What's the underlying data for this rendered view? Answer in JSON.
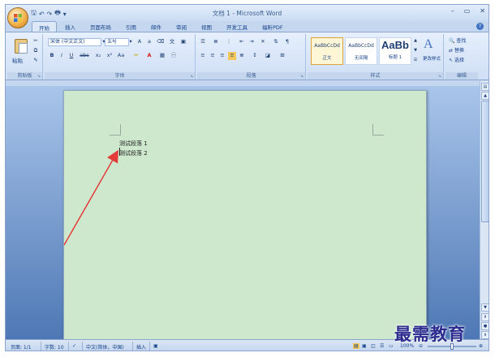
{
  "window": {
    "title": "文档 1 - Microsoft Word",
    "controls": [
      "–",
      "▭",
      "✕"
    ]
  },
  "quick_access": {
    "save": "🖫",
    "undo": "↶",
    "redo": "↷",
    "print": "🖶",
    "more": "▾"
  },
  "tabs": [
    "开始",
    "插入",
    "页面布局",
    "引用",
    "邮件",
    "审阅",
    "视图",
    "开发工具",
    "福昕PDF"
  ],
  "active_tab": "开始",
  "ribbon": {
    "clipboard": {
      "label": "剪贴板",
      "paste": "粘贴"
    },
    "font": {
      "label": "字体",
      "font_name": "宋体 (中文正文)",
      "font_size": "五号",
      "format_buttons": [
        "B",
        "I",
        "U",
        "abc",
        "x₂",
        "x²",
        "Aa",
        "A"
      ]
    },
    "paragraph": {
      "label": "段落"
    },
    "styles": {
      "label": "样式",
      "items": [
        {
          "sample": "AaBbCcDd",
          "name": "正文",
          "selected": true
        },
        {
          "sample": "AaBbCcDd",
          "name": "无间隔",
          "selected": false
        },
        {
          "sample": "AaBb",
          "name": "标题 1",
          "selected": false
        }
      ],
      "change_styles": "更改样式"
    },
    "editing": {
      "label": "编辑",
      "find": "查找",
      "replace": "替换",
      "select": "选择"
    }
  },
  "document": {
    "paragraphs": [
      "测试段落 1",
      "测试段落 2"
    ],
    "page_color": "#cde8cd",
    "arrow_color": "#e53a3a"
  },
  "statusbar": {
    "page": "页面: 1/1",
    "words": "字数: 10",
    "language": "中文(简体，中国)",
    "mode": "插入",
    "zoom": "100%",
    "zoom_level": 0.5
  },
  "watermark": "最需教育"
}
